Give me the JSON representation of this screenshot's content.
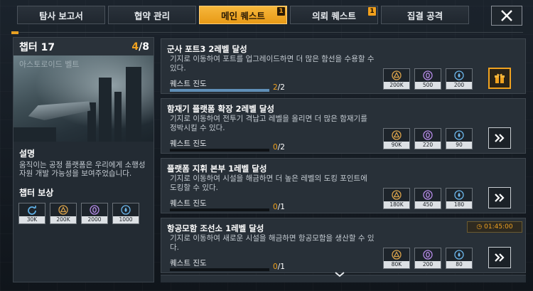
{
  "tabs": [
    {
      "label": "탐사 보고서",
      "active": false,
      "badge": ""
    },
    {
      "label": "협약 관리",
      "active": false,
      "badge": ""
    },
    {
      "label": "메인 퀘스트",
      "active": true,
      "badge": "1"
    },
    {
      "label": "의뢰 퀘스트",
      "active": false,
      "badge": "1"
    },
    {
      "label": "집결 공격",
      "active": false,
      "badge": ""
    }
  ],
  "chapter": {
    "title": "챕터 17",
    "progress_current": "4",
    "progress_total": "/8",
    "art_caption": "아스토로이드 벨트",
    "desc_heading": "설명",
    "description": "움직이는 공정 플랫폼은 우리에게 소행성 자원 개발 가능성을 보여주었습니다.",
    "reward_heading": "챕터 보상",
    "rewards": [
      {
        "icon": "refresh-icon",
        "amount": "30K"
      },
      {
        "icon": "triangle-resource-icon",
        "amount": "200K"
      },
      {
        "icon": "zero-crystal-icon",
        "amount": "2000"
      },
      {
        "icon": "blue-drop-icon",
        "amount": "1000"
      }
    ]
  },
  "quests": [
    {
      "title": "군사 포트3 2레벨 달성",
      "desc": "기지로 이동하여 포트를 업그레이드하면 더 많은 함선을 수용할 수 있다.",
      "progress_label": "퀘스트 진도",
      "progress_current": "2",
      "progress_total": "/2",
      "progress_fraction": 1.0,
      "rewards": [
        "200K",
        "500",
        "200"
      ],
      "action": "gift-icon",
      "timer": ""
    },
    {
      "title": "함재기 플랫폼 확장 2레벨 달성",
      "desc": "기지로 이동하여 전투기 격납고 레벨을 올리면 더 많은 함재기를 정박시킬 수 있다.",
      "progress_label": "퀘스트 진도",
      "progress_current": "0",
      "progress_total": "/2",
      "progress_fraction": 0,
      "rewards": [
        "90K",
        "220",
        "90"
      ],
      "action": "chevron-right-icon",
      "timer": ""
    },
    {
      "title": "플랫폼 지휘 본부 1레벨 달성",
      "desc": "기지로 이동하여 시설을 해금하면 더 높은 레벨의 도킹 포인트에 도킹할 수 있다.",
      "progress_label": "퀘스트 진도",
      "progress_current": "0",
      "progress_total": "/1",
      "progress_fraction": 0,
      "rewards": [
        "180K",
        "450",
        "180"
      ],
      "action": "chevron-right-icon",
      "timer": ""
    },
    {
      "title": "항공모함 조선소 1레벨 달성",
      "desc": "기지로 이동하여 새로운 시설을 해금하면 항공모함을 생산할 수 있다.",
      "progress_label": "퀘스트 진도",
      "progress_current": "0",
      "progress_total": "/1",
      "progress_fraction": 0,
      "rewards": [
        "80K",
        "200",
        "80"
      ],
      "action": "chevron-right-icon",
      "timer": "01:45:00"
    }
  ],
  "colors": {
    "accent": "#f0a21f",
    "progress": "#5f8fb8"
  }
}
